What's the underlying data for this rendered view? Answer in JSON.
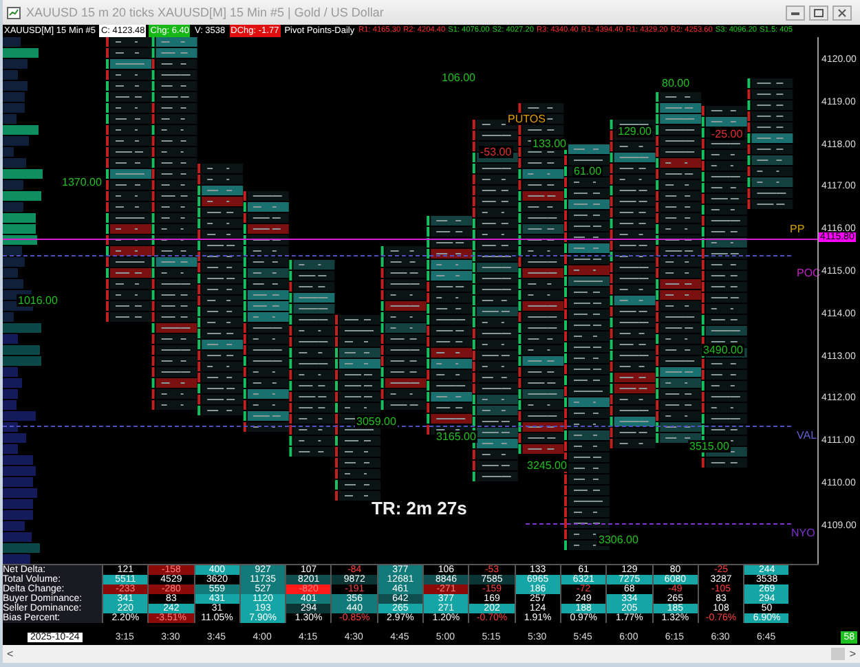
{
  "window": {
    "title": "XAUUSD 15 m 20 ticks XAUUSD[M]  15 Min  #5 | Gold / US Dollar"
  },
  "header": [
    {
      "text": "XAUUSD[M]  15 Min  #5",
      "color": "#000000"
    },
    {
      "text": "C: 4123.48",
      "color": "#ffffff"
    },
    {
      "text": "Chg: 6.40",
      "color": "#16b816"
    },
    {
      "text": "V: 3538",
      "color": "#000000"
    },
    {
      "text": "DChg: -1.77",
      "color": "#e01010"
    },
    {
      "text": "Pivot Points-Daily",
      "color": "#000000"
    }
  ],
  "pivots": [
    {
      "text": "R1: 4165.30",
      "color": "#ff3030"
    },
    {
      "text": "R2: 4204.40",
      "color": "#ff3030"
    },
    {
      "text": "S1: 4076.00",
      "color": "#20d020"
    },
    {
      "text": "S2: 4027.20",
      "color": "#20d020"
    },
    {
      "text": "R3: 4340.40",
      "color": "#ff3030"
    },
    {
      "text": "R1: 4394.40",
      "color": "#ff3030"
    },
    {
      "text": "R1: 4329.20",
      "color": "#ff3030"
    },
    {
      "text": "R2: 4253.60",
      "color": "#ff3030"
    },
    {
      "text": "S3: 4096.20",
      "color": "#20d020"
    },
    {
      "text": "S1.5: 405",
      "color": "#20d020"
    }
  ],
  "chart_labels": [
    {
      "text": "106.00",
      "color": "#20c020"
    },
    {
      "text": "PUTOS",
      "color": "#e0a000"
    },
    {
      "text": "133.00",
      "color": "#20c020"
    },
    {
      "text": "-53.00",
      "color": "#e03030"
    },
    {
      "text": "61.00",
      "color": "#20c020"
    },
    {
      "text": "129.00",
      "color": "#20c020"
    },
    {
      "text": "80.00",
      "color": "#20c020"
    },
    {
      "text": "-25.00",
      "color": "#e03030"
    },
    {
      "text": "1370.00",
      "color": "#20c020"
    },
    {
      "text": "1016.00",
      "color": "#20c020"
    },
    {
      "text": "3490.00",
      "color": "#20c020"
    },
    {
      "text": "3059.00",
      "color": "#20c020"
    },
    {
      "text": "3165.00",
      "color": "#20c020"
    },
    {
      "text": "3245.00",
      "color": "#20c020"
    },
    {
      "text": "3515.00",
      "color": "#20c020"
    },
    {
      "text": "3306.00",
      "color": "#20c020"
    }
  ],
  "timer": "TR: 2m 27s",
  "level_labels": [
    {
      "text": "PP",
      "color": "#d0a000"
    },
    {
      "text": "POC",
      "color": "#c020c0"
    },
    {
      "text": "VAL",
      "color": "#6060d0"
    },
    {
      "text": "NYO",
      "color": "#8030d0"
    }
  ],
  "price_axis": [
    "4120.00",
    "4119.00",
    "4118.00",
    "4117.00",
    "4116.00",
    "4115.00",
    "4114.00",
    "4113.00",
    "4112.00",
    "4111.00",
    "4110.00",
    "4109.00"
  ],
  "current_price": "4115.80",
  "stats": {
    "rows": [
      {
        "label": "Net Delta:",
        "cells": [
          {
            "text": "121"
          },
          {
            "text": "-158",
            "color": "#8b0b0b",
            "negative": true
          },
          {
            "text": "400",
            "color": "#15a5a5"
          },
          {
            "text": "927",
            "color": "#137a7a"
          },
          {
            "text": "107"
          },
          {
            "text": "-84",
            "negative": true
          },
          {
            "text": "377",
            "color": "#137a7a"
          },
          {
            "text": "106"
          },
          {
            "text": "-53",
            "negative": true
          },
          {
            "text": "133"
          },
          {
            "text": "61"
          },
          {
            "text": "129"
          },
          {
            "text": "80"
          },
          {
            "text": "-25",
            "negative": true
          },
          {
            "text": "244",
            "color": "#15a5a5"
          }
        ]
      },
      {
        "label": "Total Volume:",
        "cells": [
          {
            "text": "5511",
            "color": "#15a5a5"
          },
          {
            "text": "4529"
          },
          {
            "text": "3620"
          },
          {
            "text": "11735",
            "color": "#137a7a"
          },
          {
            "text": "8201",
            "color": "#0f4f4f"
          },
          {
            "text": "9872",
            "color": "#0b3535"
          },
          {
            "text": "12681",
            "color": "#137a7a"
          },
          {
            "text": "8846",
            "color": "#0f4f4f"
          },
          {
            "text": "7585",
            "color": "#0b3535"
          },
          {
            "text": "6965",
            "color": "#15a5a5"
          },
          {
            "text": "6321",
            "color": "#15a5a5"
          },
          {
            "text": "7275",
            "color": "#15a5a5"
          },
          {
            "text": "6080",
            "color": "#15a5a5"
          },
          {
            "text": "3287"
          },
          {
            "text": "3538"
          }
        ]
      },
      {
        "label": "Delta Change:",
        "cells": [
          {
            "text": "-233",
            "color": "#8b0b0b",
            "negative": true
          },
          {
            "text": "-280",
            "color": "#8b0b0b",
            "negative": true
          },
          {
            "text": "559",
            "color": "#137a7a"
          },
          {
            "text": "527",
            "color": "#137a7a"
          },
          {
            "text": "-820",
            "color": "#ff1a1a",
            "negative": true
          },
          {
            "text": "-191",
            "negative": true
          },
          {
            "text": "461",
            "color": "#137a7a"
          },
          {
            "text": "-271",
            "color": "#8b0b0b",
            "negative": true
          },
          {
            "text": "-159",
            "negative": true
          },
          {
            "text": "186",
            "color": "#15a5a5"
          },
          {
            "text": "-72",
            "negative": true
          },
          {
            "text": "68"
          },
          {
            "text": "-49",
            "negative": true
          },
          {
            "text": "-105",
            "negative": true
          },
          {
            "text": "269",
            "color": "#15a5a5"
          }
        ]
      },
      {
        "label": "Buyer Dominance:",
        "cells": [
          {
            "text": "341",
            "color": "#15a5a5"
          },
          {
            "text": "83"
          },
          {
            "text": "431",
            "color": "#15a5a5"
          },
          {
            "text": "1120",
            "color": "#15a5a5"
          },
          {
            "text": "401",
            "color": "#137a7a"
          },
          {
            "text": "356",
            "color": "#137a7a"
          },
          {
            "text": "642",
            "color": "#0f4f4f"
          },
          {
            "text": "377",
            "color": "#15a5a5"
          },
          {
            "text": "169"
          },
          {
            "text": "257"
          },
          {
            "text": "249"
          },
          {
            "text": "334",
            "color": "#15a5a5"
          },
          {
            "text": "265"
          },
          {
            "text": "83"
          },
          {
            "text": "294",
            "color": "#15a5a5"
          }
        ]
      },
      {
        "label": "Seller Dominance:",
        "cells": [
          {
            "text": "220",
            "color": "#15a5a5"
          },
          {
            "text": "242",
            "color": "#15a5a5"
          },
          {
            "text": "31"
          },
          {
            "text": "193",
            "color": "#15a5a5"
          },
          {
            "text": "294",
            "color": "#0b3535"
          },
          {
            "text": "440",
            "color": "#137a7a"
          },
          {
            "text": "265",
            "color": "#15a5a5"
          },
          {
            "text": "271",
            "color": "#15a5a5"
          },
          {
            "text": "202",
            "color": "#15a5a5"
          },
          {
            "text": "124"
          },
          {
            "text": "188",
            "color": "#15a5a5"
          },
          {
            "text": "205",
            "color": "#15a5a5"
          },
          {
            "text": "185",
            "color": "#15a5a5"
          },
          {
            "text": "108"
          },
          {
            "text": "50"
          }
        ]
      },
      {
        "label": "Bias Percent:",
        "cells": [
          {
            "text": "2.20%"
          },
          {
            "text": "-3.51%",
            "color": "#8b0b0b",
            "negative": true
          },
          {
            "text": "11.05%"
          },
          {
            "text": "7.90%",
            "color": "#15a5a5"
          },
          {
            "text": "1.30%"
          },
          {
            "text": "-0.85%",
            "negative": true
          },
          {
            "text": "2.97%"
          },
          {
            "text": "1.20%"
          },
          {
            "text": "-0.70%",
            "negative": true
          },
          {
            "text": "1.91%"
          },
          {
            "text": "0.97%"
          },
          {
            "text": "1.77%"
          },
          {
            "text": "1.32%"
          },
          {
            "text": "-0.76%",
            "negative": true
          },
          {
            "text": "6.90%",
            "color": "#15a5a5"
          }
        ]
      }
    ]
  },
  "date": "2025-10-24",
  "times": [
    "3:15",
    "3:30",
    "3:45",
    "4:00",
    "4:15",
    "4:30",
    "4:45",
    "5:00",
    "5:15",
    "5:30",
    "5:45",
    "6:00",
    "6:15",
    "6:30",
    "6:45"
  ],
  "badge": "58",
  "scroll_left": "<",
  "scroll_right": ">"
}
